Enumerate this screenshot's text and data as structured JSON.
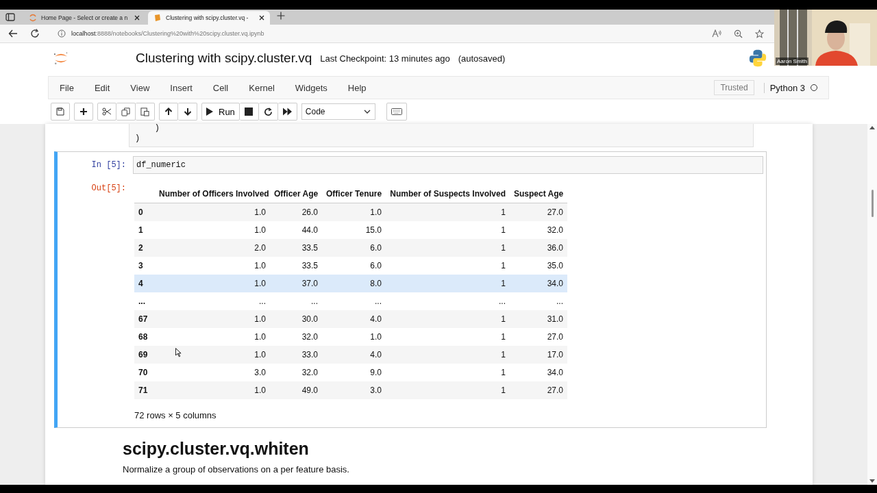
{
  "browser": {
    "tabs": [
      {
        "title": "Home Page - Select or create a n",
        "selected": false
      },
      {
        "title": "Clustering with scipy.cluster.vq -",
        "selected": true
      }
    ],
    "url_host": "localhost",
    "url_rest": ":8888/notebooks/Clustering%20with%20scipy.cluster.vq.ipynb"
  },
  "webcam": {
    "kind": "picture",
    "name": "Aaron Smith"
  },
  "notebook": {
    "title": "Clustering with scipy.cluster.vq",
    "checkpoint": "Last Checkpoint: 13 minutes ago",
    "autosave": "(autosaved)",
    "menu": [
      "File",
      "Edit",
      "View",
      "Insert",
      "Cell",
      "Kernel",
      "Widgets",
      "Help"
    ],
    "trusted": "Trusted",
    "kernel": "Python 3",
    "run_label": "Run",
    "cell_type": "Code"
  },
  "prev_cell": {
    "lines": [
      "    )",
      ")"
    ]
  },
  "cell": {
    "in_prompt": "In [5]:",
    "code": "df_numeric",
    "out_prompt": "Out[5]:",
    "columns": [
      "",
      "Number of Officers Involved",
      "Officer Age",
      "Officer Tenure",
      "Number of Suspects Involved",
      "Suspect Age"
    ],
    "rows": [
      {
        "cells": [
          "0",
          "1.0",
          "26.0",
          "1.0",
          "1",
          "27.0"
        ],
        "highlighted": false
      },
      {
        "cells": [
          "1",
          "1.0",
          "44.0",
          "15.0",
          "1",
          "32.0"
        ],
        "highlighted": false
      },
      {
        "cells": [
          "2",
          "2.0",
          "33.5",
          "6.0",
          "1",
          "36.0"
        ],
        "highlighted": false
      },
      {
        "cells": [
          "3",
          "1.0",
          "33.5",
          "6.0",
          "1",
          "35.0"
        ],
        "highlighted": false
      },
      {
        "cells": [
          "4",
          "1.0",
          "37.0",
          "8.0",
          "1",
          "34.0"
        ],
        "highlighted": true
      },
      {
        "cells": [
          "...",
          "...",
          "...",
          "...",
          "...",
          "..."
        ],
        "highlighted": false
      },
      {
        "cells": [
          "67",
          "1.0",
          "30.0",
          "4.0",
          "1",
          "31.0"
        ],
        "highlighted": false
      },
      {
        "cells": [
          "68",
          "1.0",
          "32.0",
          "1.0",
          "1",
          "27.0"
        ],
        "highlighted": false
      },
      {
        "cells": [
          "69",
          "1.0",
          "33.0",
          "4.0",
          "1",
          "17.0"
        ],
        "highlighted": false
      },
      {
        "cells": [
          "70",
          "3.0",
          "32.0",
          "9.0",
          "1",
          "34.0"
        ],
        "highlighted": false
      },
      {
        "cells": [
          "71",
          "1.0",
          "49.0",
          "3.0",
          "1",
          "27.0"
        ],
        "highlighted": false
      }
    ],
    "summary": "72 rows × 5 columns"
  },
  "markdown": {
    "heading": "scipy.cluster.vq.whiten",
    "text": "Normalize a group of observations on a per feature basis."
  }
}
